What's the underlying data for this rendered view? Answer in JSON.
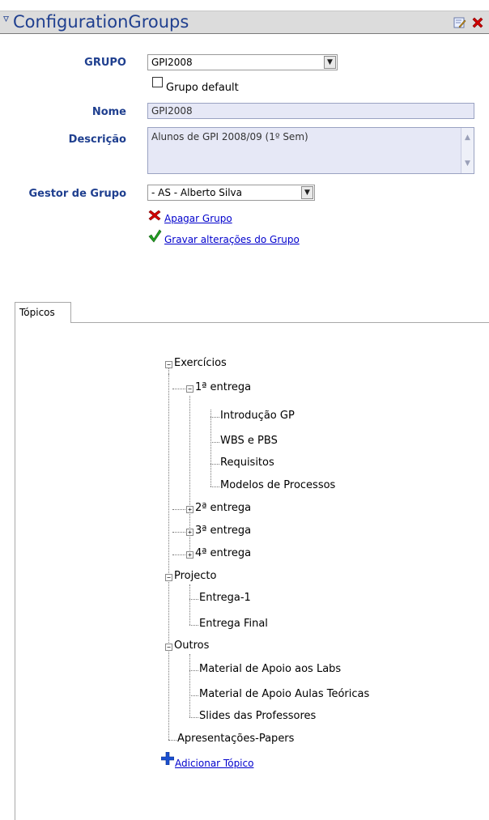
{
  "header": {
    "title": "ConfigurationGroups",
    "toggle_icon": "collapse-triangle-icon",
    "edit_icon": "edit-icon",
    "close_icon": "close-icon"
  },
  "form": {
    "grupo_label": "GRUPO",
    "grupo_value": "GPI2008",
    "default_label": "Grupo default",
    "default_checked": false,
    "nome_label": "Nome",
    "nome_value": "GPI2008",
    "descricao_label": "Descrição",
    "descricao_value": "Alunos de GPI 2008/09 (1º Sem)",
    "gestor_label": "Gestor de Grupo",
    "gestor_value": "- AS - Alberto Silva",
    "delete_link": "Apagar Grupo",
    "save_link": "Gravar alterações do Grupo"
  },
  "tabs": [
    {
      "label": "Tópicos",
      "selected": true
    }
  ],
  "tree": {
    "exercicios": "Exercícios",
    "entrega1": "1ª entrega",
    "introducao": "Introdução GP",
    "wbs": "WBS e PBS",
    "requisitos": "Requisitos",
    "modelos": "Modelos de Processos",
    "entrega2": "2ª entrega",
    "entrega3": "3ª entrega",
    "entrega4": "4ª entrega",
    "projecto": "Projecto",
    "entregaum": "Entrega-1",
    "entregafinal": "Entrega Final",
    "outros": "Outros",
    "material_labs": "Material de Apoio aos Labs",
    "material_aulas": "Material de Apoio Aulas Teóricas",
    "slides": "Slides das Professores",
    "apresentacoes": "Apresentações-Papers"
  },
  "add_topic": "Adicionar Tópico",
  "colors": {
    "title_blue": "#1f3f8f",
    "link_blue": "#0000cc",
    "delete_red": "#cc0000",
    "save_green": "#1a8a1a",
    "add_blue": "#1a4fd0"
  }
}
